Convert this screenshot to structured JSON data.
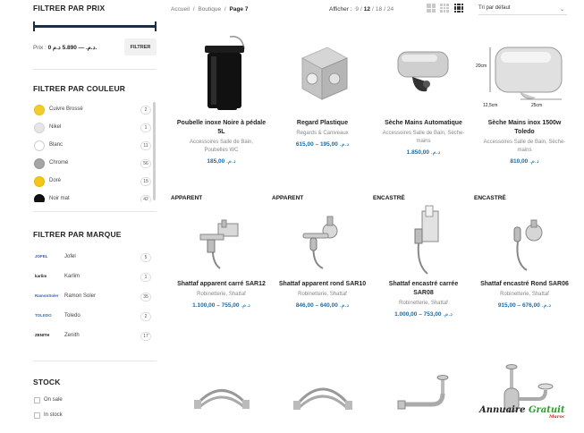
{
  "sidebar": {
    "price": {
      "title": "FILTRER PAR PRIX",
      "label": "Prix :",
      "range": "0 د.م. — 5.890 د.م.",
      "button": "FILTRER"
    },
    "color": {
      "title": "FILTRER PAR COULEUR",
      "items": [
        {
          "label": "Cuivre Brossé",
          "count": "2",
          "color": "#f2cc2c",
          "border": "#e5c021"
        },
        {
          "label": "Nikel",
          "count": "1",
          "color": "#e6e6e6",
          "border": "#d4d4d4"
        },
        {
          "label": "Blanc",
          "count": "11",
          "color": "#ffffff",
          "border": "#d0d0d0"
        },
        {
          "label": "Chromé",
          "count": "56",
          "color": "#a5a5a5",
          "border": "#959595"
        },
        {
          "label": "Doré",
          "count": "15",
          "color": "#f5c518",
          "border": "#e6b70c"
        },
        {
          "label": "Noir mat",
          "count": "42",
          "color": "#111111",
          "border": "#000000"
        }
      ]
    },
    "brand": {
      "title": "FILTRER PAR MARQUE",
      "items": [
        {
          "label": "Jofel",
          "count": "5",
          "logo": "JOFEL",
          "logo_color": "#3a56a8"
        },
        {
          "label": "Karlim",
          "count": "1",
          "logo": "karlim",
          "logo_color": "#222222"
        },
        {
          "label": "Ramon Soler",
          "count": "35",
          "logo": "RamonSoler",
          "logo_color": "#2a66b8"
        },
        {
          "label": "Toledo",
          "count": "2",
          "logo": "TOLEDO",
          "logo_color": "#3b6ec0"
        },
        {
          "label": "Zenith",
          "count": "17",
          "logo": "ZENITH",
          "logo_color": "#1a1a1a"
        }
      ]
    },
    "stock": {
      "title": "STOCK",
      "items": [
        {
          "label": "On sale"
        },
        {
          "label": "In stock"
        }
      ]
    }
  },
  "topbar": {
    "breadcrumb": [
      "Accueil",
      "Boutique",
      "Page 7"
    ],
    "show_label": "Afficher :",
    "show_options": [
      "9",
      "12",
      "18",
      "24"
    ],
    "show_active": "12",
    "sort": "Tri par défaut"
  },
  "products": [
    {
      "title": "Poubelle inoxe Noire à pédale 5L",
      "category": "Accessoires Salle de Bain, Poubelles WC",
      "price": "185,00",
      "currency": "د.م.",
      "image": "trash-bin"
    },
    {
      "title": "Regard Plastique",
      "category": "Regards & Caniveaux",
      "price": "195,00 – 615,00",
      "currency": "د.م.",
      "image": "junction-box"
    },
    {
      "title": "Sèche Mains Automatique",
      "category": "Accessoires Salle de Bain, Sèche-mains",
      "price": "1.850,00",
      "currency": "د.م.",
      "image": "hand-dryer"
    },
    {
      "title": "Sèche Mains inox 1500w Toledo",
      "category": "Accessoires Salle de Bain, Sèche-mains",
      "price": "810,00",
      "currency": "د.م.",
      "image": "hand-dryer-dim"
    },
    {
      "tag": "APPARENT",
      "title": "Shattaf apparent carré SAR12",
      "category": "Robinetterie, Shattaf",
      "price": "755,00 – 1.100,00",
      "currency": "د.م.",
      "image": "shattaf-square"
    },
    {
      "tag": "APPARENT",
      "title": "Shattaf apparent rond SAR10",
      "category": "Robinetterie, Shattaf",
      "price": "640,00 – 846,00",
      "currency": "د.م.",
      "image": "shattaf-round"
    },
    {
      "tag": "ENCASTRÉ",
      "title": "Shattaf encastré carrée SAR08",
      "category": "Robinetterie, Shattaf",
      "price": "753,00 – 1.000,00",
      "currency": "د.م.",
      "image": "shattaf-plate"
    },
    {
      "tag": "ENCASTRÉ",
      "title": "Shattaf encastré Rond SAR06",
      "category": "Robinetterie, Shattaf",
      "price": "676,00 – 915,00",
      "currency": "د.م.",
      "image": "shattaf-wall"
    },
    {
      "image": "hoses-1"
    },
    {
      "image": "hoses-2"
    },
    {
      "image": "siphon-1"
    },
    {
      "image": "siphon-2"
    }
  ],
  "dim_labels": {
    "height": "20cm",
    "width": "25cm",
    "depth": "12,5cm"
  },
  "watermark": {
    "text": "Annuaire ",
    "highlight": "Gratuit",
    "sub": "Maroc"
  }
}
